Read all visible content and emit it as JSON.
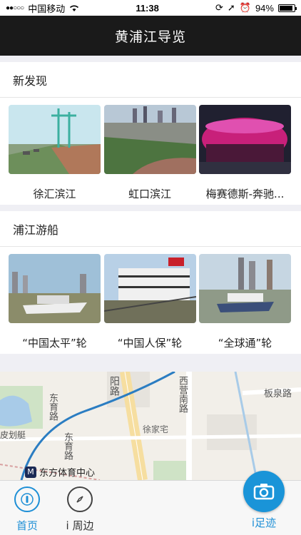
{
  "status_bar": {
    "carrier": "中国移动",
    "time": "11:38",
    "battery": "94%",
    "signal_icon": "signal-dots-icon",
    "wifi_icon": "wifi-icon"
  },
  "nav": {
    "title": "黄浦江导览"
  },
  "sections": [
    {
      "title": "新发现",
      "cards": [
        {
          "title": "徐汇滨江"
        },
        {
          "title": "虹口滨江"
        },
        {
          "title": "梅赛德斯-奔驰..."
        }
      ]
    },
    {
      "title": "浦江游船",
      "cards": [
        {
          "title": "“中国太平”轮"
        },
        {
          "title": "“中国人保”轮"
        },
        {
          "title": "“全球通”轮"
        }
      ]
    }
  ],
  "map": {
    "labels": {
      "road_dongyu_1": "东育路",
      "road_dongyu_2": "东育路",
      "road_yang": "阳路",
      "road_xiying": "西营南路",
      "road_banquan": "板泉路",
      "place_xujiazhai": "徐家宅",
      "place_pihuating": "皮划艇",
      "metro_station": "东方体育中心"
    }
  },
  "tabbar": {
    "home": "首页",
    "nearby": "i 周边",
    "footprint": "i足迹"
  },
  "colors": {
    "accent": "#1e8fd6",
    "nav_bg": "#1a1a1a"
  }
}
